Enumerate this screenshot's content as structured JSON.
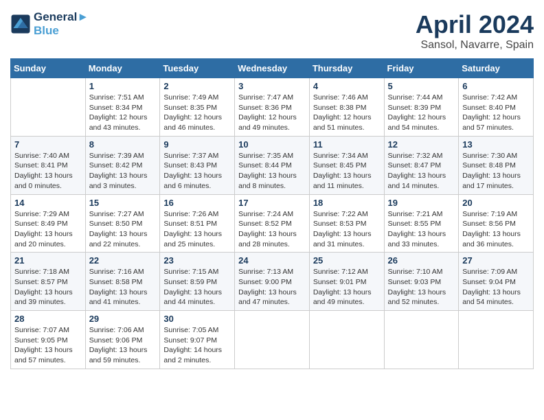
{
  "header": {
    "logo_line1": "General",
    "logo_line2": "Blue",
    "month": "April 2024",
    "location": "Sansol, Navarre, Spain"
  },
  "days_of_week": [
    "Sunday",
    "Monday",
    "Tuesday",
    "Wednesday",
    "Thursday",
    "Friday",
    "Saturday"
  ],
  "weeks": [
    [
      {
        "day": "",
        "info": ""
      },
      {
        "day": "1",
        "info": "Sunrise: 7:51 AM\nSunset: 8:34 PM\nDaylight: 12 hours\nand 43 minutes."
      },
      {
        "day": "2",
        "info": "Sunrise: 7:49 AM\nSunset: 8:35 PM\nDaylight: 12 hours\nand 46 minutes."
      },
      {
        "day": "3",
        "info": "Sunrise: 7:47 AM\nSunset: 8:36 PM\nDaylight: 12 hours\nand 49 minutes."
      },
      {
        "day": "4",
        "info": "Sunrise: 7:46 AM\nSunset: 8:38 PM\nDaylight: 12 hours\nand 51 minutes."
      },
      {
        "day": "5",
        "info": "Sunrise: 7:44 AM\nSunset: 8:39 PM\nDaylight: 12 hours\nand 54 minutes."
      },
      {
        "day": "6",
        "info": "Sunrise: 7:42 AM\nSunset: 8:40 PM\nDaylight: 12 hours\nand 57 minutes."
      }
    ],
    [
      {
        "day": "7",
        "info": "Sunrise: 7:40 AM\nSunset: 8:41 PM\nDaylight: 13 hours\nand 0 minutes."
      },
      {
        "day": "8",
        "info": "Sunrise: 7:39 AM\nSunset: 8:42 PM\nDaylight: 13 hours\nand 3 minutes."
      },
      {
        "day": "9",
        "info": "Sunrise: 7:37 AM\nSunset: 8:43 PM\nDaylight: 13 hours\nand 6 minutes."
      },
      {
        "day": "10",
        "info": "Sunrise: 7:35 AM\nSunset: 8:44 PM\nDaylight: 13 hours\nand 8 minutes."
      },
      {
        "day": "11",
        "info": "Sunrise: 7:34 AM\nSunset: 8:45 PM\nDaylight: 13 hours\nand 11 minutes."
      },
      {
        "day": "12",
        "info": "Sunrise: 7:32 AM\nSunset: 8:47 PM\nDaylight: 13 hours\nand 14 minutes."
      },
      {
        "day": "13",
        "info": "Sunrise: 7:30 AM\nSunset: 8:48 PM\nDaylight: 13 hours\nand 17 minutes."
      }
    ],
    [
      {
        "day": "14",
        "info": "Sunrise: 7:29 AM\nSunset: 8:49 PM\nDaylight: 13 hours\nand 20 minutes."
      },
      {
        "day": "15",
        "info": "Sunrise: 7:27 AM\nSunset: 8:50 PM\nDaylight: 13 hours\nand 22 minutes."
      },
      {
        "day": "16",
        "info": "Sunrise: 7:26 AM\nSunset: 8:51 PM\nDaylight: 13 hours\nand 25 minutes."
      },
      {
        "day": "17",
        "info": "Sunrise: 7:24 AM\nSunset: 8:52 PM\nDaylight: 13 hours\nand 28 minutes."
      },
      {
        "day": "18",
        "info": "Sunrise: 7:22 AM\nSunset: 8:53 PM\nDaylight: 13 hours\nand 31 minutes."
      },
      {
        "day": "19",
        "info": "Sunrise: 7:21 AM\nSunset: 8:55 PM\nDaylight: 13 hours\nand 33 minutes."
      },
      {
        "day": "20",
        "info": "Sunrise: 7:19 AM\nSunset: 8:56 PM\nDaylight: 13 hours\nand 36 minutes."
      }
    ],
    [
      {
        "day": "21",
        "info": "Sunrise: 7:18 AM\nSunset: 8:57 PM\nDaylight: 13 hours\nand 39 minutes."
      },
      {
        "day": "22",
        "info": "Sunrise: 7:16 AM\nSunset: 8:58 PM\nDaylight: 13 hours\nand 41 minutes."
      },
      {
        "day": "23",
        "info": "Sunrise: 7:15 AM\nSunset: 8:59 PM\nDaylight: 13 hours\nand 44 minutes."
      },
      {
        "day": "24",
        "info": "Sunrise: 7:13 AM\nSunset: 9:00 PM\nDaylight: 13 hours\nand 47 minutes."
      },
      {
        "day": "25",
        "info": "Sunrise: 7:12 AM\nSunset: 9:01 PM\nDaylight: 13 hours\nand 49 minutes."
      },
      {
        "day": "26",
        "info": "Sunrise: 7:10 AM\nSunset: 9:03 PM\nDaylight: 13 hours\nand 52 minutes."
      },
      {
        "day": "27",
        "info": "Sunrise: 7:09 AM\nSunset: 9:04 PM\nDaylight: 13 hours\nand 54 minutes."
      }
    ],
    [
      {
        "day": "28",
        "info": "Sunrise: 7:07 AM\nSunset: 9:05 PM\nDaylight: 13 hours\nand 57 minutes."
      },
      {
        "day": "29",
        "info": "Sunrise: 7:06 AM\nSunset: 9:06 PM\nDaylight: 13 hours\nand 59 minutes."
      },
      {
        "day": "30",
        "info": "Sunrise: 7:05 AM\nSunset: 9:07 PM\nDaylight: 14 hours\nand 2 minutes."
      },
      {
        "day": "",
        "info": ""
      },
      {
        "day": "",
        "info": ""
      },
      {
        "day": "",
        "info": ""
      },
      {
        "day": "",
        "info": ""
      }
    ]
  ]
}
